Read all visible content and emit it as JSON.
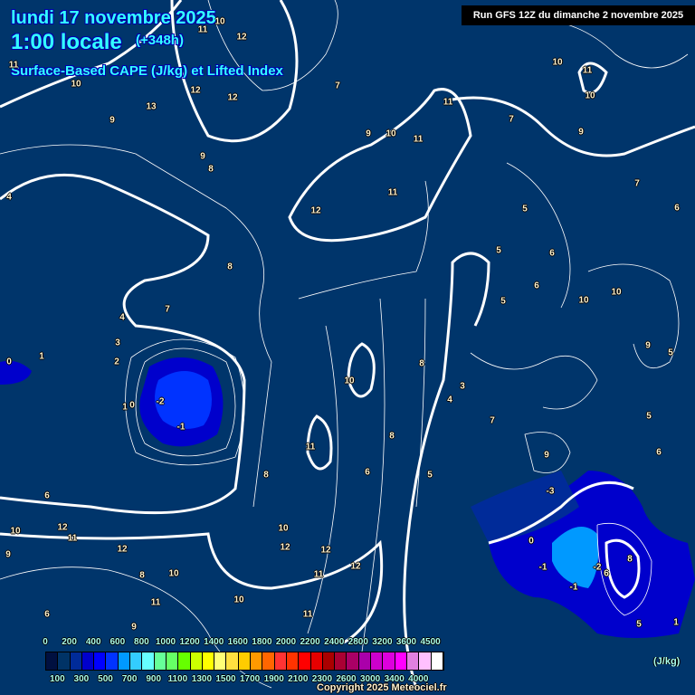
{
  "header": {
    "date": "lundi 17 novembre 2025",
    "time": "1:00 locale",
    "lead": "(+348h)",
    "parameter": "Surface-Based CAPE (J/kg) et Lifted Index",
    "run": "Run GFS 12Z du dimanche 2 novembre 2025"
  },
  "legend": {
    "colors": [
      "#001040",
      "#003366",
      "#002b99",
      "#0000cc",
      "#0000ff",
      "#0033ff",
      "#0099ff",
      "#33ccff",
      "#66ffff",
      "#66ff99",
      "#66ff66",
      "#66ff00",
      "#ccff00",
      "#ffff00",
      "#ffff77",
      "#ffe040",
      "#ffcc00",
      "#ff9900",
      "#ff6600",
      "#ff3333",
      "#ff3300",
      "#ff0000",
      "#e60000",
      "#aa0000",
      "#aa0033",
      "#aa0066",
      "#aa00aa",
      "#cc00cc",
      "#dd00dd",
      "#ff00ff",
      "#e080e0",
      "#ffc0ff",
      "#ffffff"
    ],
    "top_labels": [
      "0",
      "200",
      "400",
      "600",
      "800",
      "1000",
      "1200",
      "1400",
      "1600",
      "1800",
      "2000",
      "2200",
      "2400",
      "2800",
      "3200",
      "3600",
      "4500"
    ],
    "bottom_labels": [
      "100",
      "300",
      "500",
      "700",
      "900",
      "1100",
      "1300",
      "1500",
      "1700",
      "1900",
      "2100",
      "2300",
      "2600",
      "3000",
      "3400",
      "4000"
    ],
    "unit": "(J/kg)"
  },
  "contour_labels": [
    "11",
    "10",
    "11",
    "12",
    "12",
    "12",
    "13",
    "10",
    "8",
    "9",
    "9",
    "8",
    "4",
    "7",
    "7",
    "12",
    "9",
    "10",
    "11",
    "11",
    "11",
    "7",
    "9",
    "10",
    "11",
    "10",
    "7",
    "5",
    "5",
    "6",
    "6",
    "5",
    "10",
    "10",
    "9",
    "6",
    "5",
    "4",
    "3",
    "2",
    "1",
    "0",
    "1",
    "0",
    "-2",
    "-1",
    "8",
    "10",
    "8",
    "6",
    "5",
    "4",
    "3",
    "6",
    "7",
    "8",
    "9",
    "6",
    "5",
    "-3",
    "0",
    "-1",
    "-1",
    "-2",
    "6",
    "8",
    "10",
    "12",
    "11",
    "10",
    "11",
    "12",
    "9",
    "12",
    "11",
    "10",
    "12",
    "12",
    "11",
    "10",
    "11",
    "8",
    "9",
    "5",
    "1",
    "6"
  ],
  "copyright": "Copyright 2025 Meteociel.fr"
}
